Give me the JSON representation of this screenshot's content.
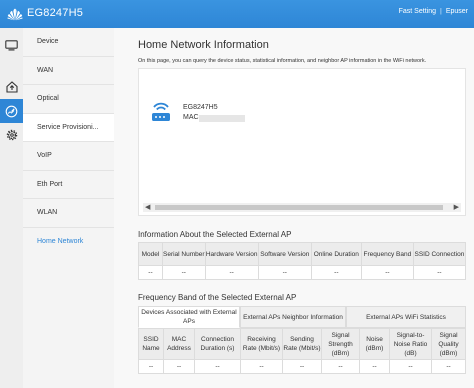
{
  "app": {
    "brand_color": "#2e86d6",
    "model": "EG8247H5",
    "logo_icon": "huawei-logo-icon"
  },
  "topnav": {
    "fast_setting": "Fast Setting",
    "separator": "|",
    "user": "Epuser"
  },
  "rail": {
    "items": [
      {
        "icon": "monitor-icon"
      },
      {
        "icon": "home-upload-icon"
      },
      {
        "icon": "gauge-icon",
        "active": true
      },
      {
        "icon": "gear-icon"
      }
    ]
  },
  "subnav": {
    "items": [
      {
        "label": "Device"
      },
      {
        "label": "WAN"
      },
      {
        "label": "Optical"
      },
      {
        "label": "Service Provisioni..."
      },
      {
        "label": "VoIP"
      },
      {
        "label": "Eth Port"
      },
      {
        "label": "WLAN"
      },
      {
        "label": "Home Network"
      }
    ]
  },
  "main": {
    "title": "Home Network Information",
    "description": "On this page, you can query the device status, statistical information, and neighbor AP information in the WiFi network.",
    "device": {
      "name": "EG8247H5",
      "mac_label": "MAC:"
    }
  },
  "ap_info": {
    "title": "Information About the Selected External AP",
    "headers": [
      "Model",
      "Serial Number",
      "Hardware Version",
      "Software Version",
      "Online Duration",
      "Frequency Band",
      "SSID Connection"
    ],
    "row": [
      "--",
      "--",
      "--",
      "--",
      "--",
      "--",
      "--"
    ]
  },
  "freq": {
    "title": "Frequency Band of the Selected External AP",
    "tabs": [
      {
        "label": "Devices Associated with External APs"
      },
      {
        "label": "External APs Neighbor Information"
      },
      {
        "label": "External APs WiFi Statistics"
      }
    ],
    "headers": [
      "SSID Name",
      "MAC Address",
      "Connection Duration (s)",
      "Receiving Rate (Mbit/s)",
      "Sending Rate (Mbit/s)",
      "Signal Strength (dBm)",
      "Noise (dBm)",
      "Signal-to-Noise Ratio (dB)",
      "Signal Quality (dBm)"
    ],
    "row": [
      "--",
      "--",
      "--",
      "--",
      "--",
      "--",
      "--",
      "--",
      "--"
    ]
  }
}
